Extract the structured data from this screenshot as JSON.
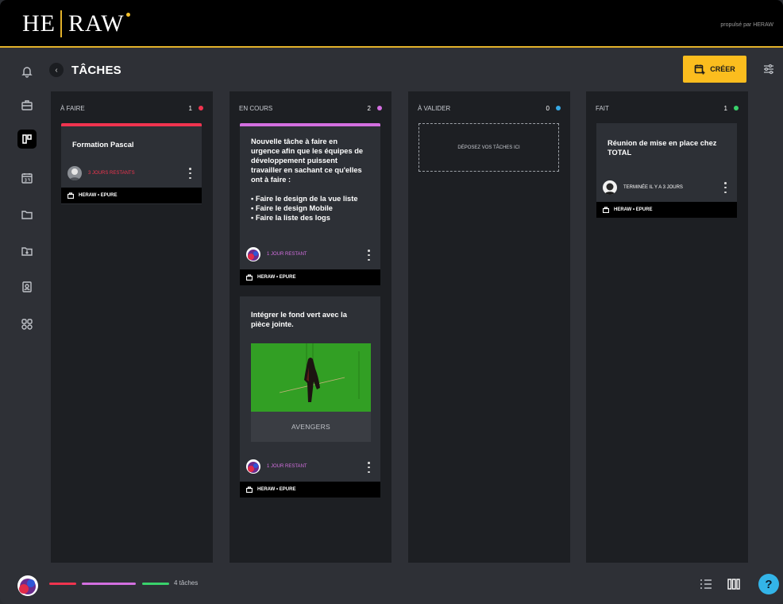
{
  "brand": {
    "logo_left": "HE",
    "logo_right": "RAW",
    "powered_by": "propulsé par HERAW"
  },
  "header": {
    "back_icon": "chevron-left-icon",
    "title": "TÂCHES",
    "create_label": "CRÉER"
  },
  "colors": {
    "accent": "#fbbd1e",
    "todo": "#f0344f",
    "inprogress": "#d36fe0",
    "tovalidate": "#36a9e6",
    "done": "#39d26b"
  },
  "columns": [
    {
      "label": "À FAIRE",
      "count": "1"
    },
    {
      "label": "EN COURS",
      "count": "2"
    },
    {
      "label": "À VALIDER",
      "count": "0"
    },
    {
      "label": "FAIT",
      "count": "1"
    }
  ],
  "cards": {
    "todo_1": {
      "title": "Formation Pascal",
      "meta": "3 JOURS RESTANTS",
      "project": "HERAW • EPURE"
    },
    "inprogress_1": {
      "title": "Nouvelle tâche à faire en\nurgence afin que les équipes de\ndéveloppement puissent\ntravailler en sachant ce qu'elles\nont à faire :\n\n• Faire le design de la vue liste\n• Faire le design Mobile\n• Faire la liste des logs",
      "meta": "1 JOUR RESTANT",
      "project": "HERAW • EPURE"
    },
    "inprogress_2": {
      "title": "Intégrer le fond vert avec la\npièce jointe.",
      "attachment_label": "AVENGERS",
      "meta": "1 JOUR RESTANT",
      "project": "HERAW • EPURE"
    },
    "done_1": {
      "title": "Réunion de mise en place chez\nTOTAL",
      "meta": "TERMINÉE IL Y A 3 JOURS",
      "project": "HERAW • EPURE"
    }
  },
  "dropzone": {
    "label": "DÉPOSEZ VOS TÂCHES ICI"
  },
  "footer": {
    "task_count": "4 tâches",
    "help": "?"
  }
}
